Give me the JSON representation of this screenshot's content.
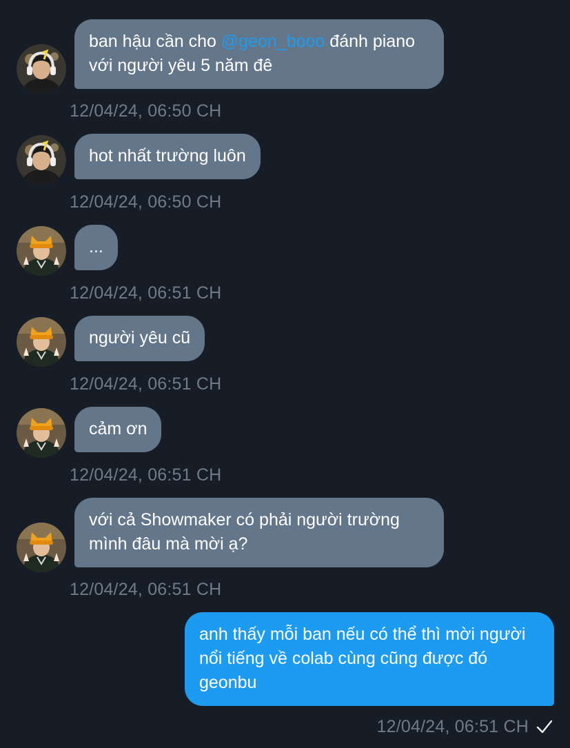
{
  "conversation": {
    "messages": [
      {
        "sender": "other",
        "avatar": "avatar-headphones",
        "text_before": "ban hậu cần cho ",
        "mention": "@geon_booo",
        "text_after": " đánh piano với người yêu 5 năm đê",
        "time": "12/04/24, 06:50 CH"
      },
      {
        "sender": "other",
        "avatar": "avatar-headphones",
        "text": "hot nhất trường luôn",
        "time": "12/04/24, 06:50 CH"
      },
      {
        "sender": "other",
        "avatar": "avatar-cat-hat",
        "text": "...",
        "time": "12/04/24, 06:51 CH"
      },
      {
        "sender": "other",
        "avatar": "avatar-cat-hat",
        "text": "người yêu cũ",
        "time": "12/04/24, 06:51 CH"
      },
      {
        "sender": "other",
        "avatar": "avatar-cat-hat",
        "text": "cảm ơn",
        "time": "12/04/24, 06:51 CH"
      },
      {
        "sender": "other",
        "avatar": "avatar-cat-hat",
        "text": "với cả Showmaker có phải người trường mình đâu mà mời ạ?",
        "time": "12/04/24, 06:51 CH"
      },
      {
        "sender": "me",
        "text": "anh thấy mỗi ban nếu có thể thì mời người nổi tiếng về colab cùng cũng được đó geonbu",
        "time": "12/04/24, 06:51 CH",
        "status_icon": "check-icon"
      }
    ]
  },
  "colors": {
    "background": "#161d26",
    "incoming_bubble": "#64768a",
    "outgoing_bubble": "#1d9bf0",
    "mention": "#1d9bf0",
    "timestamp": "#6f7c88"
  }
}
